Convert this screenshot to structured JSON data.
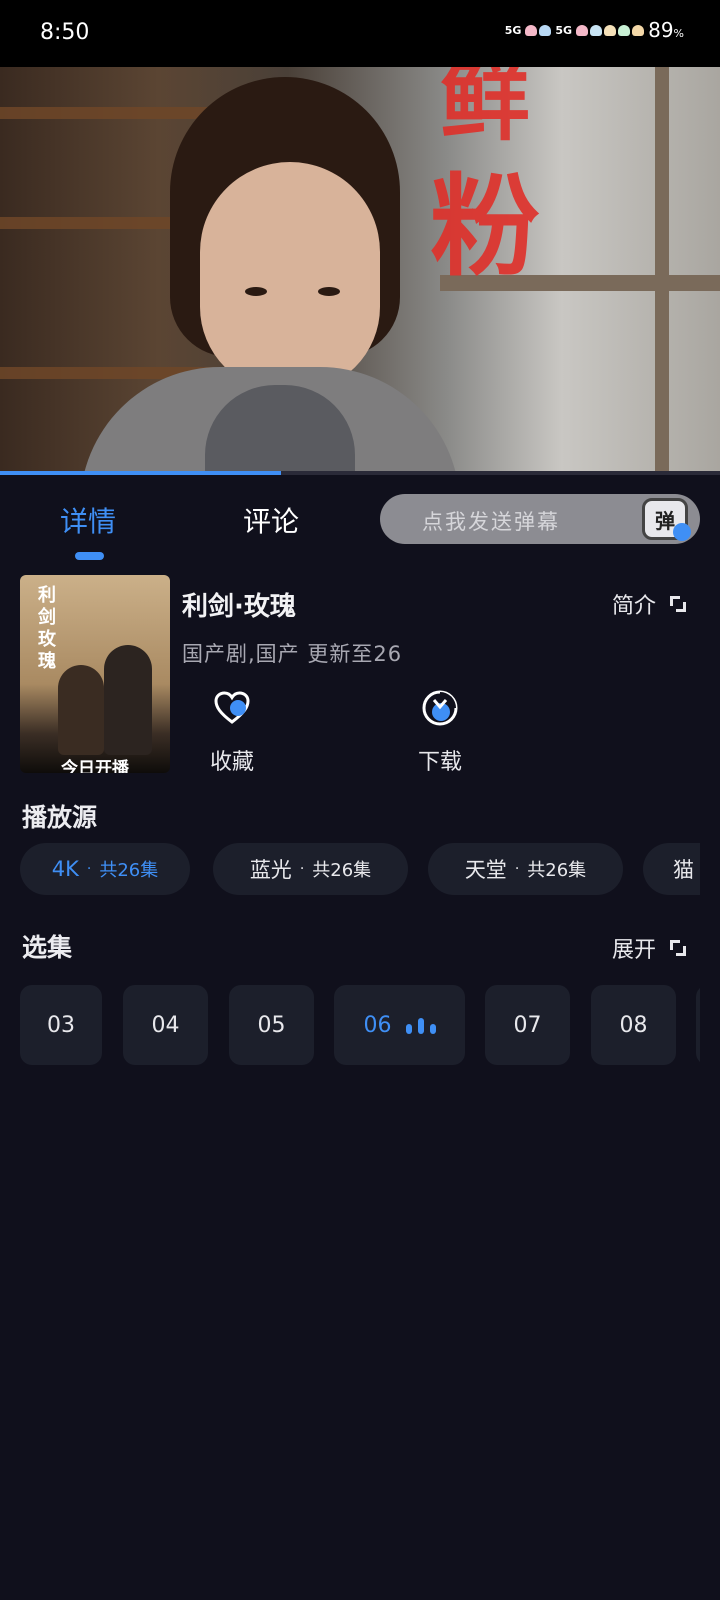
{
  "status_bar": {
    "time": "8:50",
    "network_1": "5G",
    "network_2": "5G",
    "battery": "89",
    "battery_unit": "%"
  },
  "video": {
    "sign_text": "粉",
    "progress": 0.39
  },
  "tabs": {
    "details": "详情",
    "comments": "评论"
  },
  "danmaku": {
    "placeholder": "点我发送弹幕",
    "icon_text": "弹"
  },
  "show": {
    "poster_title": "利剑玫瑰",
    "poster_caption": "今日开播",
    "title": "利剑·玫瑰",
    "synopsis_label": "简介",
    "meta": "国产剧,国产 更新至26"
  },
  "actions": {
    "favorite": "收藏",
    "download": "下载"
  },
  "sources": {
    "title": "播放源",
    "items": [
      {
        "name": "4K",
        "count": "共26集"
      },
      {
        "name": "蓝光",
        "count": "共26集"
      },
      {
        "name": "天堂",
        "count": "共26集"
      },
      {
        "name": "猫",
        "count": ""
      }
    ]
  },
  "episodes": {
    "title": "选集",
    "expand_label": "展开",
    "items": [
      "03",
      "04",
      "05",
      "06",
      "07",
      "08"
    ],
    "current": "06"
  },
  "colors": {
    "accent": "#3f8ff5",
    "background": "#10101c",
    "chip": "#1c1f2b"
  }
}
